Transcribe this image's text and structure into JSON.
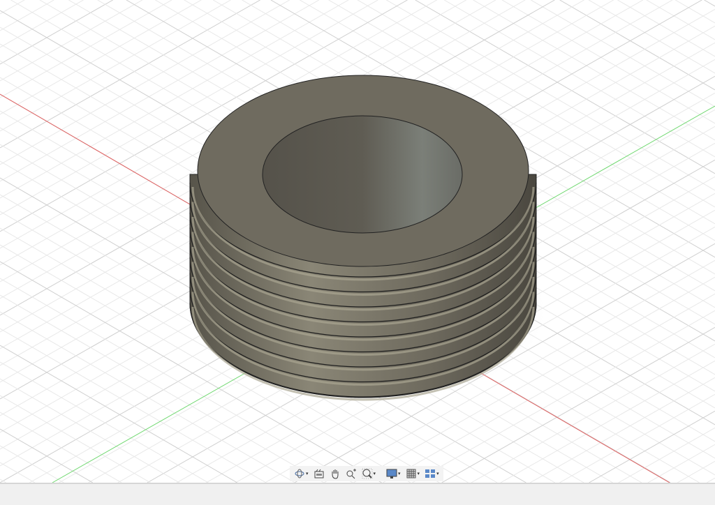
{
  "viewport": {
    "colors": {
      "x_axis": "#e06060",
      "y_axis": "#60d060",
      "grid": "#dcdcdc",
      "body": "#6e6a5e"
    }
  },
  "nav_toolbar": {
    "items": [
      {
        "icon": "orbit-icon",
        "dropdown": true
      },
      {
        "icon": "look-at-icon",
        "dropdown": false
      },
      {
        "icon": "pan-icon",
        "dropdown": false
      },
      {
        "icon": "zoom-icon",
        "dropdown": false
      },
      {
        "icon": "fit-icon",
        "dropdown": true
      },
      {
        "icon": "display-settings-icon",
        "dropdown": true
      },
      {
        "icon": "grid-settings-icon",
        "dropdown": true
      },
      {
        "icon": "viewports-icon",
        "dropdown": true
      }
    ],
    "dropdown_glyph": "▾"
  }
}
